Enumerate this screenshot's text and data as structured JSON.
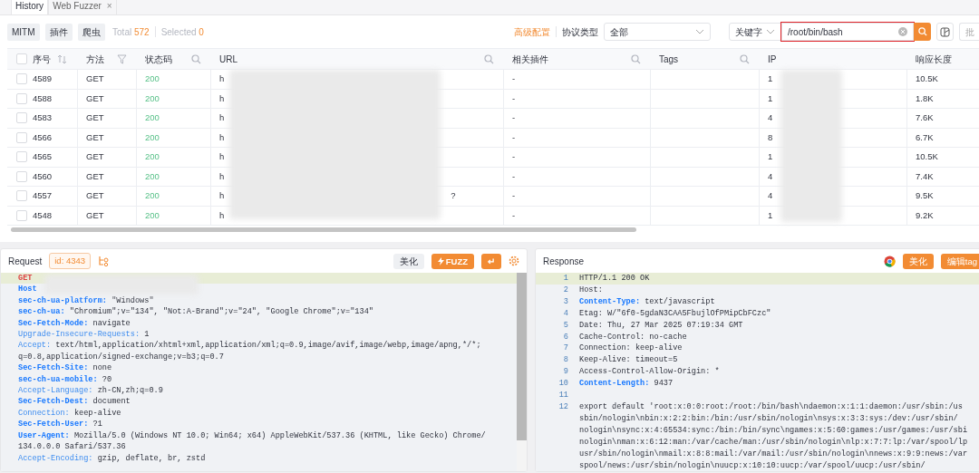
{
  "tabs": [
    {
      "label": "History",
      "selected": true,
      "closable": false
    },
    {
      "label": "Web Fuzzer",
      "selected": false,
      "closable": true,
      "close_icon": "×"
    }
  ],
  "toolbar": {
    "buttons": [
      "MITM",
      "插件",
      "爬虫"
    ],
    "total_label": "Total",
    "total": "572",
    "selected_label": "Selected",
    "selected_count": "0",
    "advanced": "高级配置",
    "protocol_label": "协议类型",
    "protocol_value": "全部",
    "search_type": "关键字",
    "search_value": "/root/bin/bash",
    "search_highlighted": true,
    "cut_button": "批"
  },
  "table": {
    "all_checked": false,
    "columns": [
      {
        "label": "序号",
        "kind": "sort"
      },
      {
        "label": "方法",
        "kind": "filter"
      },
      {
        "label": "状态码",
        "kind": "search"
      },
      {
        "label": "URL",
        "kind": "search"
      },
      {
        "label": "相关插件",
        "kind": "search"
      },
      {
        "label": "Tags",
        "kind": "search"
      },
      {
        "label": "IP",
        "kind": "plain"
      },
      {
        "label": "响应长度",
        "kind": "plain"
      }
    ],
    "rows": [
      {
        "checked": false,
        "id": "4589",
        "method": "GET",
        "status": "200",
        "url": "h",
        "plugin": "-",
        "ip": "1",
        "length": "10.5K"
      },
      {
        "checked": false,
        "id": "4588",
        "method": "GET",
        "status": "200",
        "url": "h",
        "plugin": "-",
        "ip": "1",
        "length": "1.8K"
      },
      {
        "checked": false,
        "id": "4583",
        "method": "GET",
        "status": "200",
        "url": "h",
        "plugin": "-",
        "ip": "4",
        "length": "7.6K"
      },
      {
        "checked": false,
        "id": "4566",
        "method": "GET",
        "status": "200",
        "url": "h",
        "plugin": "-",
        "ip": "8",
        "length": "6.7K"
      },
      {
        "checked": false,
        "id": "4565",
        "method": "GET",
        "status": "200",
        "url": "h",
        "plugin": "-",
        "ip": "1",
        "length": "10.5K"
      },
      {
        "checked": false,
        "id": "4560",
        "method": "GET",
        "status": "200",
        "url": "h",
        "plugin": "-",
        "ip": "4",
        "length": "7.4K"
      },
      {
        "checked": false,
        "id": "4557",
        "method": "GET",
        "status": "200",
        "url": "h",
        "url_tail": "?",
        "plugin": "-",
        "ip": "4",
        "length": "9.5K"
      },
      {
        "checked": false,
        "id": "4548",
        "method": "GET",
        "status": "200",
        "url": "h",
        "plugin": "-",
        "ip": "1",
        "length": "9.2K"
      }
    ]
  },
  "request": {
    "title": "Request",
    "id_badge": "id: 4343",
    "beautify": "美化",
    "fuzz": "FUZZ",
    "enter_key": "↵",
    "lines": [
      {
        "kind": "method",
        "key": "GET",
        "bold": true
      },
      {
        "kind": "header",
        "key": "Host",
        "bold": true
      },
      {
        "kind": "header",
        "key": "sec-ch-ua-platform:",
        "value": " \"Windows\"",
        "bold": true
      },
      {
        "kind": "header",
        "key": "sec-ch-ua:",
        "value": " \"Chromium\";v=\"134\", \"Not:A-Brand\";v=\"24\", \"Google Chrome\";v=\"134\"",
        "bold": true
      },
      {
        "kind": "header",
        "key": "Sec-Fetch-Mode:",
        "value": " navigate",
        "bold": true
      },
      {
        "kind": "header",
        "key": "Upgrade-Insecure-Requests:",
        "value": " 1",
        "bold": false
      },
      {
        "kind": "header",
        "key": "Accept:",
        "value": " text/html,application/xhtml+xml,application/xml;q=0.9,image/avif,image/webp,image/apng,*/*;",
        "bold": false
      },
      {
        "kind": "continuation",
        "value": "q=0.8,application/signed-exchange;v=b3;q=0.7"
      },
      {
        "kind": "header",
        "key": "Sec-Fetch-Site:",
        "value": " none",
        "bold": true
      },
      {
        "kind": "header",
        "key": "sec-ch-ua-mobile:",
        "value": " ?0",
        "bold": true
      },
      {
        "kind": "header",
        "key": "Accept-Language:",
        "value": " zh-CN,zh;q=0.9",
        "bold": false
      },
      {
        "kind": "header",
        "key": "Sec-Fetch-Dest:",
        "value": " document",
        "bold": true
      },
      {
        "kind": "header",
        "key": "Connection:",
        "value": " keep-alive",
        "bold": false
      },
      {
        "kind": "header",
        "key": "Sec-Fetch-User:",
        "value": " ?1",
        "bold": true
      },
      {
        "kind": "header",
        "key": "User-Agent:",
        "value": " Mozilla/5.0 (Windows NT 10.0; Win64; x64) AppleWebKit/537.36 (KHTML, like Gecko) Chrome/",
        "bold": true
      },
      {
        "kind": "continuation",
        "value": "134.0.0.0 Safari/537.36"
      },
      {
        "kind": "header",
        "key": "Accept-Encoding:",
        "value": " gzip, deflate, br, zstd",
        "bold": false
      }
    ]
  },
  "response": {
    "title": "Response",
    "beautify": "美化",
    "edit_tag": "编辑tag",
    "lines": [
      {
        "number": "1",
        "key": "HTTP/1.1 200 OK",
        "highlight": false
      },
      {
        "number": "2",
        "key": "Host:",
        "highlight": false
      },
      {
        "number": "3",
        "key": "Content-Type:",
        "value": " text/javascript",
        "highlight": true
      },
      {
        "number": "4",
        "key": "Etag:",
        "value": " W/\"6f0-5gdaN3CAA5FbujlOfPMipCbFCzc\"",
        "highlight": false
      },
      {
        "number": "5",
        "key": "Date:",
        "value": " Thu, 27 Mar 2025 07:19:34 GMT",
        "highlight": false
      },
      {
        "number": "6",
        "key": "Cache-Control:",
        "value": " no-cache",
        "highlight": false
      },
      {
        "number": "7",
        "key": "Connection:",
        "value": " keep-alive",
        "highlight": false
      },
      {
        "number": "8",
        "key": "Keep-Alive:",
        "value": " timeout=5",
        "highlight": false
      },
      {
        "number": "9",
        "key": "Access-Control-Allow-Origin:",
        "value": " *",
        "highlight": false
      },
      {
        "number": "10",
        "key": "Content-Length:",
        "value": " 9437",
        "highlight": true
      },
      {
        "number": "11"
      },
      {
        "number": "12",
        "key": "export default 'root:x:0:0:root:/root:/bin/bash\\ndaemon:x:1:1:daemon:/usr/sbin:/us",
        "highlight": false
      },
      {
        "key": "sbin/nologin\\nbin:x:2:2:bin:/bin:/usr/sbin/nologin\\nsys:x:3:3:sys:/dev:/usr/sbin/",
        "highlight": false
      },
      {
        "key": "nologin\\nsync:x:4:65534:sync:/bin:/bin/sync\\ngames:x:5:60:games:/usr/games:/usr/sbi",
        "highlight": false
      },
      {
        "key": "nologin\\nman:x:6:12:man:/var/cache/man:/usr/sbin/nologin\\nlp:x:7:7:lp:/var/spool/lp",
        "highlight": false
      },
      {
        "key": "usr/sbin/nologin\\nmail:x:8:8:mail:/var/mail:/usr/sbin/nologin\\nnews:x:9:9:news:/var",
        "highlight": false
      },
      {
        "key": "spool/news:/usr/sbin/nologin\\nuucp:x:10:10:uucp:/var/spool/uucp:/usr/sbin/",
        "highlight": false
      }
    ]
  }
}
